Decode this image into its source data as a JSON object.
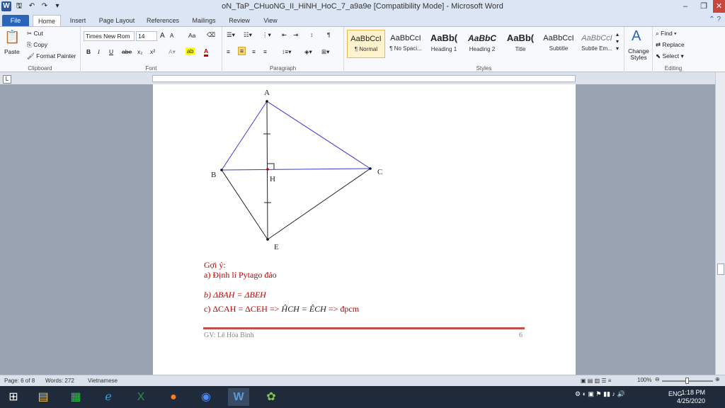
{
  "window": {
    "title": "oN_TaP_CHuoNG_II_HiNH_HoC_7_a9a9e [Compatibility Mode]  -  Microsoft Word",
    "app_icon": "W"
  },
  "tabs": [
    "File",
    "Home",
    "Insert",
    "Page Layout",
    "References",
    "Mailings",
    "Review",
    "View"
  ],
  "ribbon": {
    "clipboard": {
      "paste": "Paste",
      "cut": "Cut",
      "copy": "Copy",
      "format_painter": "Format Painter",
      "label": "Clipboard"
    },
    "font": {
      "name": "Times New Rom",
      "size": "14",
      "label": "Font",
      "bold": "B",
      "italic": "I",
      "underline": "U",
      "strike": "abe",
      "sub": "x₂",
      "sup": "x²",
      "grow": "A",
      "shrink": "A",
      "case": "Aa"
    },
    "paragraph": {
      "label": "Paragraph"
    },
    "styles": {
      "label": "Styles",
      "items": [
        {
          "sample": "AaBbCcI",
          "name": "¶ Normal"
        },
        {
          "sample": "AaBbCcI",
          "name": "¶ No Spaci..."
        },
        {
          "sample": "AaBb(",
          "name": "Heading 1"
        },
        {
          "sample": "AaBbC",
          "name": "Heading 2"
        },
        {
          "sample": "AaBb(",
          "name": "Title"
        },
        {
          "sample": "AaBbCcI",
          "name": "Subtitle"
        },
        {
          "sample": "AaBbCcI",
          "name": "Subtle Em..."
        }
      ],
      "change_styles": "Change Styles"
    },
    "editing": {
      "find": "Find",
      "replace": "Replace",
      "select": "Select",
      "label": "Editing"
    }
  },
  "document": {
    "diagram_labels": {
      "A": "A",
      "B": "B",
      "C": "C",
      "H": "H",
      "E": "E"
    },
    "hint_title": "Gợi ý:",
    "hint_a": "a) Định lí Pytago đảo",
    "hint_b": "b)  ΔBAH = ΔBEH",
    "hint_c_prefix": "c)  ΔCAH = ΔCEH => ",
    "hint_c_math": "ĤCH = ÊCH",
    "hint_c_suffix": " => đpcm",
    "footer_author": "GV: Lê Hòa Bình",
    "footer_page": "6"
  },
  "status": {
    "page": "Page: 6 of 8",
    "words": "Words: 272",
    "language": "Vietnamese",
    "zoom": "100%"
  },
  "taskbar": {
    "lang": "ENG",
    "time": "1:18 PM",
    "date": "4/25/2020"
  }
}
